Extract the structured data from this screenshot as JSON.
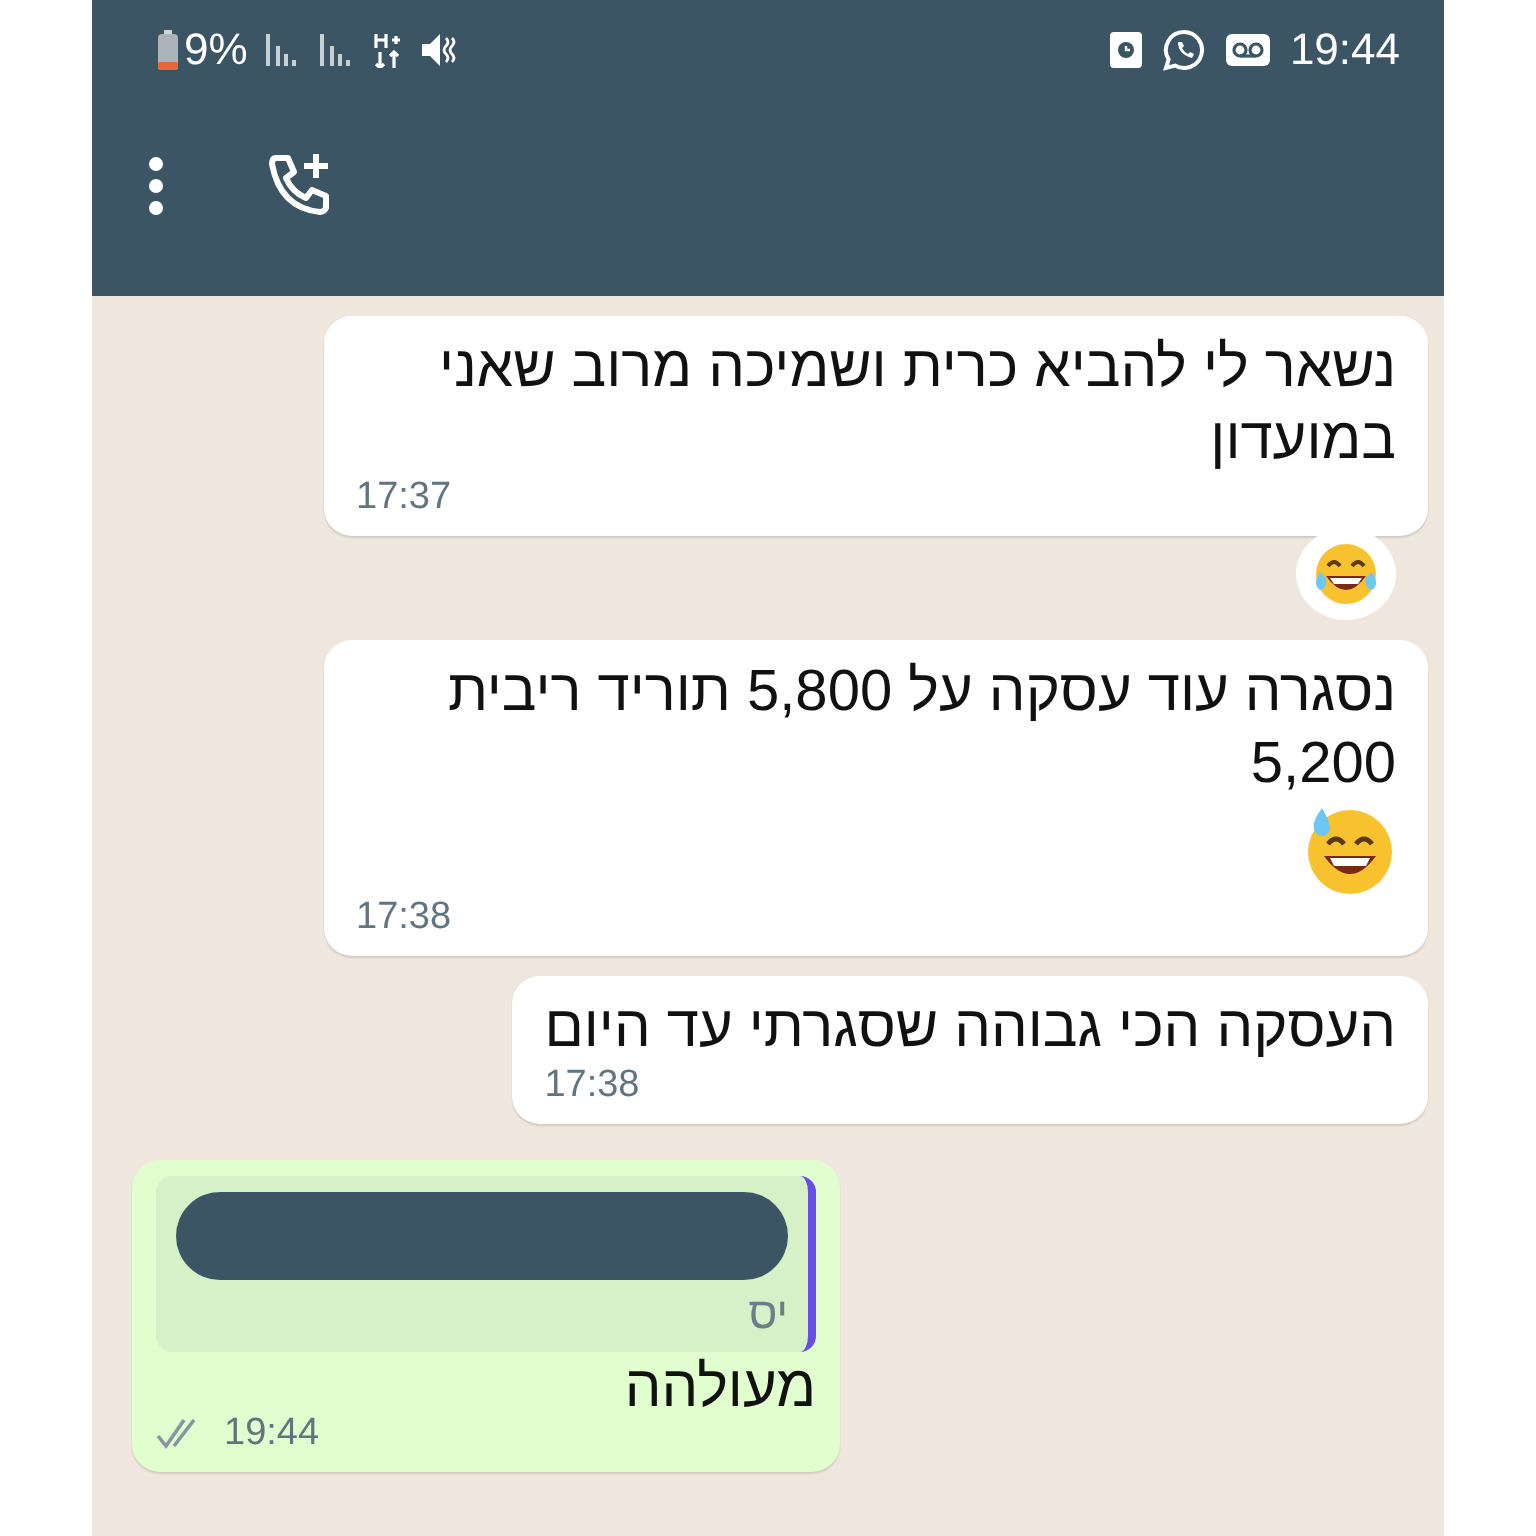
{
  "status_bar": {
    "battery": "9%",
    "time": "19:44"
  },
  "messages": [
    {
      "kind": "incoming",
      "text": "נשאר לי להביא כרית ושמיכה מרוב שאני במועדון",
      "time": "17:37",
      "reaction": true,
      "emoji_after": false
    },
    {
      "kind": "incoming",
      "text": "נסגרה עוד עסקה על 5,800 תוריד ריבית 5,200",
      "time": "17:38",
      "reaction": false,
      "emoji_after": true
    },
    {
      "kind": "incoming",
      "text": "העסקה הכי גבוהה שסגרתי עד היום",
      "time": "17:38",
      "reaction": false,
      "emoji_after": false
    },
    {
      "kind": "outgoing",
      "quote": {
        "author": "יס"
      },
      "text": "מעולהה",
      "time": "19:44",
      "read": false
    }
  ]
}
